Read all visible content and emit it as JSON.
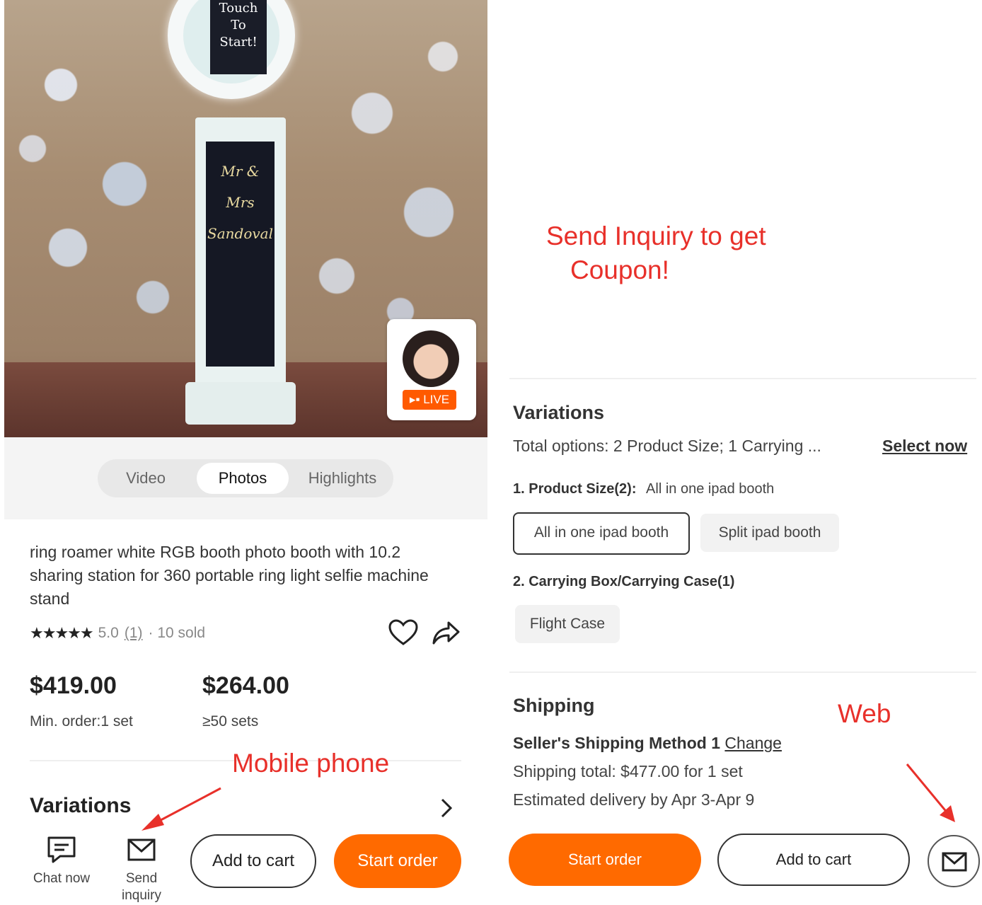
{
  "annotations": {
    "promo_line1": "Send Inquiry to get",
    "promo_line2": "Coupon!",
    "mobile_label": "Mobile phone",
    "web_label": "Web",
    "color": "#e8302a"
  },
  "mobile": {
    "hero": {
      "ring_text": "Touch To Start!",
      "booth_text": "Mr & Mrs Sandoval",
      "live_badge": "LIVE"
    },
    "media_tabs": [
      "Video",
      "Photos",
      "Highlights"
    ],
    "active_tab": "Photos",
    "product_title": "ring roamer white RGB booth photo booth with 10.2 sharing station for 360 portable ring light selfie machine stand",
    "stars": "★★★★★",
    "rating_score": "5.0",
    "review_count": "(1)",
    "sold": "· 10 sold",
    "prices": [
      {
        "price": "$419.00",
        "condition": "Min. order:1 set"
      },
      {
        "price": "$264.00",
        "condition": "≥50 sets"
      }
    ],
    "variations_title": "Variations",
    "actions": {
      "chat": "Chat now",
      "inquiry_line1": "Send",
      "inquiry_line2": "inquiry",
      "add_to_cart": "Add to cart",
      "start_order": "Start order"
    },
    "accent": "#ff6a00"
  },
  "web": {
    "variations_title": "Variations",
    "total_options": "Total options: 2 Product Size; 1 Carrying ...",
    "select_now": "Select now",
    "size_label": "1. Product Size(2):",
    "size_selected": "All in one ipad booth",
    "size_options": [
      "All in one ipad booth",
      "Split ipad booth"
    ],
    "case_label": "2. Carrying Box/Carrying Case(1)",
    "case_options": [
      "Flight Case"
    ],
    "shipping_title": "Shipping",
    "shipping_method": "Seller's Shipping Method 1",
    "change": "Change",
    "shipping_total": "Shipping total: $477.00 for 1 set",
    "delivery": "Estimated delivery by Apr 3-Apr 9",
    "start_order": "Start order",
    "add_to_cart": "Add to cart",
    "accent": "#ff6a00"
  }
}
